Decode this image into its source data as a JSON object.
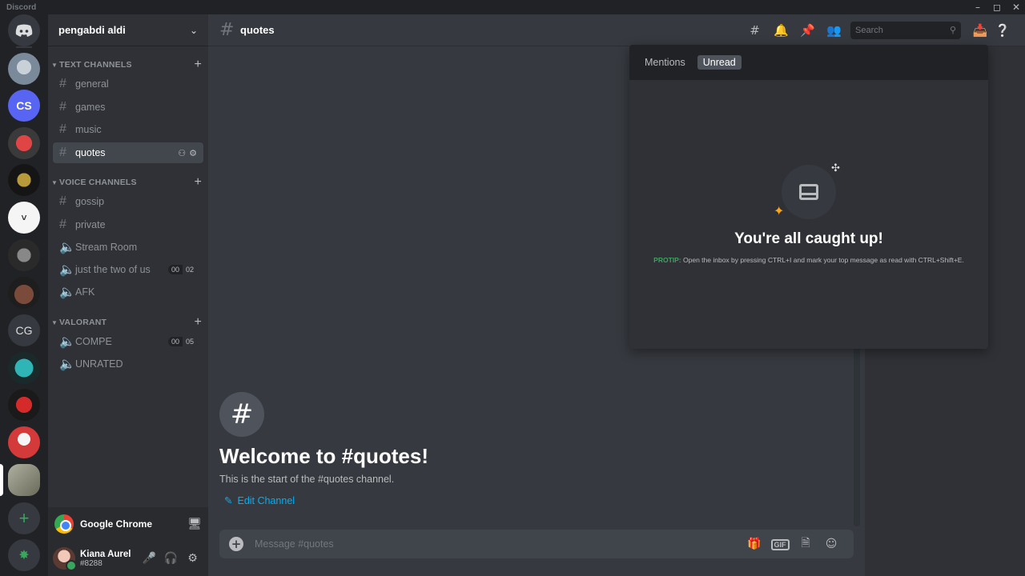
{
  "window": {
    "app_name": "Discord"
  },
  "servers": [
    {
      "name": "home",
      "icon": "discord-logo-icon",
      "bg": "#36393f"
    },
    {
      "name": "server-1",
      "icon": "avatar-image",
      "bg": "#7a8a9a"
    },
    {
      "name": "server-2",
      "text": "CS",
      "bg": "#5865f2"
    },
    {
      "name": "server-3",
      "icon": "badge-image",
      "bg": "#3a3a3a"
    },
    {
      "name": "server-4",
      "icon": "figure-image",
      "bg": "#151515"
    },
    {
      "name": "server-5",
      "icon": "white-avatar",
      "bg": "#f5f5f5"
    },
    {
      "name": "server-6",
      "icon": "logo-image",
      "bg": "#2a2a2a"
    },
    {
      "name": "server-7",
      "icon": "mascot-image",
      "bg": "#5a3a2a"
    },
    {
      "name": "server-8",
      "text": "CG",
      "bg": "#36393f"
    },
    {
      "name": "server-9",
      "icon": "teal-logo",
      "bg": "#1f8a8a"
    },
    {
      "name": "server-10",
      "icon": "red-logo",
      "bg": "#1a1a1a"
    },
    {
      "name": "server-11",
      "icon": "santa-image",
      "bg": "#d43a3a"
    },
    {
      "name": "server-12",
      "icon": "group-photo",
      "bg": "#8a8a7a"
    }
  ],
  "guild": {
    "name": "pengabdi aldi"
  },
  "categories": {
    "text": "TEXT CHANNELS",
    "voice": "VOICE CHANNELS",
    "valorant": "VALORANT"
  },
  "channels": {
    "text": [
      "general",
      "games",
      "music",
      "quotes"
    ],
    "voice": [
      "gossip",
      "private",
      "Stream Room",
      "just the two of us",
      "AFK"
    ],
    "valorant": [
      "COMPE",
      "UNRATED"
    ],
    "counters": {
      "just_the_two": [
        "00",
        "02"
      ],
      "compe": [
        "00",
        "05"
      ]
    }
  },
  "activity": {
    "label": "Google Chrome"
  },
  "user": {
    "name": "Kiana Aurel",
    "tag": "#8288"
  },
  "topbar": {
    "channel": "quotes",
    "search_placeholder": "Search"
  },
  "welcome": {
    "title": "Welcome to #quotes!",
    "subtitle": "This is the start of the #quotes channel.",
    "edit": "Edit Channel"
  },
  "composer": {
    "placeholder": "Message #quotes",
    "gif": "GIF"
  },
  "inbox": {
    "tabs": [
      "Mentions",
      "Unread"
    ],
    "selected": "Unread",
    "empty_title": "You're all caught up!",
    "protip_label": "PROTIP:",
    "protip_text": "Open the inbox by pressing CTRL+I and mark your top message as read with CTRL+Shift+E."
  },
  "colors": {
    "accent": "#5865f2",
    "link": "#00aff4",
    "online": "#3ba55d",
    "protip": "#3ba55d"
  }
}
